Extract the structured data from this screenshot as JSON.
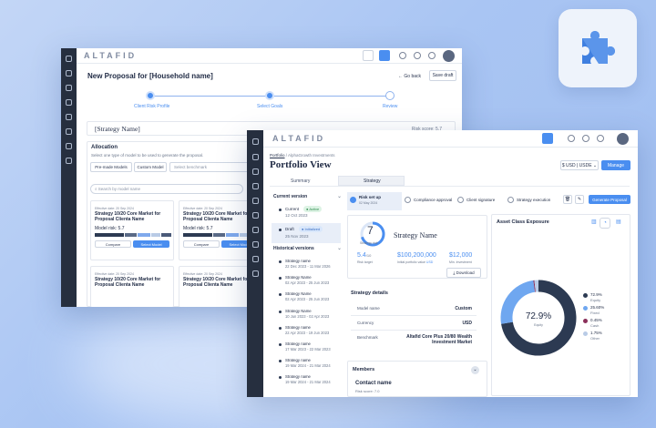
{
  "back": {
    "logo": "ALTAFID",
    "title": "New Proposal for [Household name]",
    "go_back": "Go back",
    "save_draft": "Save draft",
    "steps": [
      "Client Risk Profile",
      "Select Goals",
      "Review"
    ],
    "strategy_name": "[Strategy Name]",
    "risk_score": "Risk score: 5.7",
    "allocation_title": "Allocation",
    "allocation_desc": "Select one type of model to be used to generate the proposal.",
    "tab_premade": "Pre-made Models",
    "tab_custom": "Custom Model",
    "benchmark_placeholder": "Select benchmark",
    "search_placeholder": "Search by model name",
    "cards": [
      {
        "date": "Effective date: 20 Sep 2024",
        "name": "Strategy 10/20 Core Market for Proposal Clienta Name",
        "risk": "Model risk: 5.7",
        "compare": "Compare",
        "select": "Select Model"
      },
      {
        "date": "Effective date: 20 Sep 2024",
        "name": "Strategy 10/20 Core Market for Proposal Clienta Name",
        "risk": "Model risk: 5.7",
        "compare": "Compare",
        "select": "Select Model"
      },
      {
        "date": "Effective date: 20 Sep 2024",
        "name": "Strategy 10/20 Core Market for Proposal Clienta Name"
      },
      {
        "date": "Effective date: 20 Sep 2024",
        "name": "Strategy 10/20 Core Market for Proposal Clienta Name"
      }
    ]
  },
  "front": {
    "logo": "ALTAFID",
    "breadcrumb": [
      "Portfolio",
      "AlphaGrowth Investments"
    ],
    "title": "Portfolio View",
    "currency": "$ USD | USDE",
    "manage": "Manage",
    "tabs": [
      "Summary",
      "Strategy"
    ],
    "current_version": "Current version",
    "versions": [
      {
        "label": "Current",
        "badge": "Active",
        "date": "12 Oct 2023"
      },
      {
        "label": "Draft",
        "badge": "Initialized",
        "date": "25 Nov 2023"
      }
    ],
    "historical": "Historical versions",
    "history": [
      {
        "name": "Strategy name",
        "date": "22 Dec 2023 - 11 Mar 2026"
      },
      {
        "name": "Strategy Name",
        "date": "02 Apr 2023 - 25 Jun 2023"
      },
      {
        "name": "Strategy Name",
        "date": "02 Apr 2023 - 25 Jun 2023"
      },
      {
        "name": "Strategy Name",
        "date": "10 Jun 2023 - 02 Apr 2023"
      },
      {
        "name": "Strategy name",
        "date": "22 Apr 2023 - 19 Jun 2023"
      },
      {
        "name": "Strategy name",
        "date": "17 Mar 2023 - 22 Mar 2023"
      },
      {
        "name": "Strategy name",
        "date": "19 Mar 2024 - 21 Mar 2024"
      },
      {
        "name": "Strategy name",
        "date": "19 Mar 2024 - 21 Mar 2024"
      }
    ],
    "pipeline": [
      {
        "label": "Risk set up",
        "date": "02 May 2024"
      },
      {
        "label": "Compliance approval"
      },
      {
        "label": "Client signature"
      },
      {
        "label": "Strategy execution"
      }
    ],
    "generate": "Generate Proposal",
    "score": "7",
    "score_label": "Strategy risk",
    "strategy_name": "Strategy Name",
    "risk_target": "5.4",
    "risk_target_sub": "/10",
    "risk_target_label": "Risk target",
    "initial_amount": "$100,200,000",
    "initial_label": "Initial portfolio value",
    "initial_unit": "USD",
    "min_amount": "$12,000",
    "min_label": "Min. Investment",
    "download": "Download",
    "details_title": "Strategy details",
    "details": [
      {
        "k": "Model name",
        "v": "Custom"
      },
      {
        "k": "Currency",
        "v": "USD"
      },
      {
        "k": "Benchmark",
        "v": "Altafid Core Plus 20/80 Wealth Investment Market"
      }
    ],
    "members": "Members",
    "contact_name": "Contact name",
    "contact_risk": "Risk score: 7.0",
    "asset_title": "Asset Class Exposure",
    "donut_value": "72.9%",
    "donut_label": "Equity",
    "legend": [
      {
        "pct": "72.9%",
        "name": "Equity",
        "color": "#2c3a52"
      },
      {
        "pct": "25.60%",
        "name": "Fixed",
        "color": "#6fa7f0"
      },
      {
        "pct": "0.45%",
        "name": "Cash",
        "color": "#8a2f5a"
      },
      {
        "pct": "1.75%",
        "name": "Other",
        "color": "#b9cbe6"
      }
    ]
  }
}
